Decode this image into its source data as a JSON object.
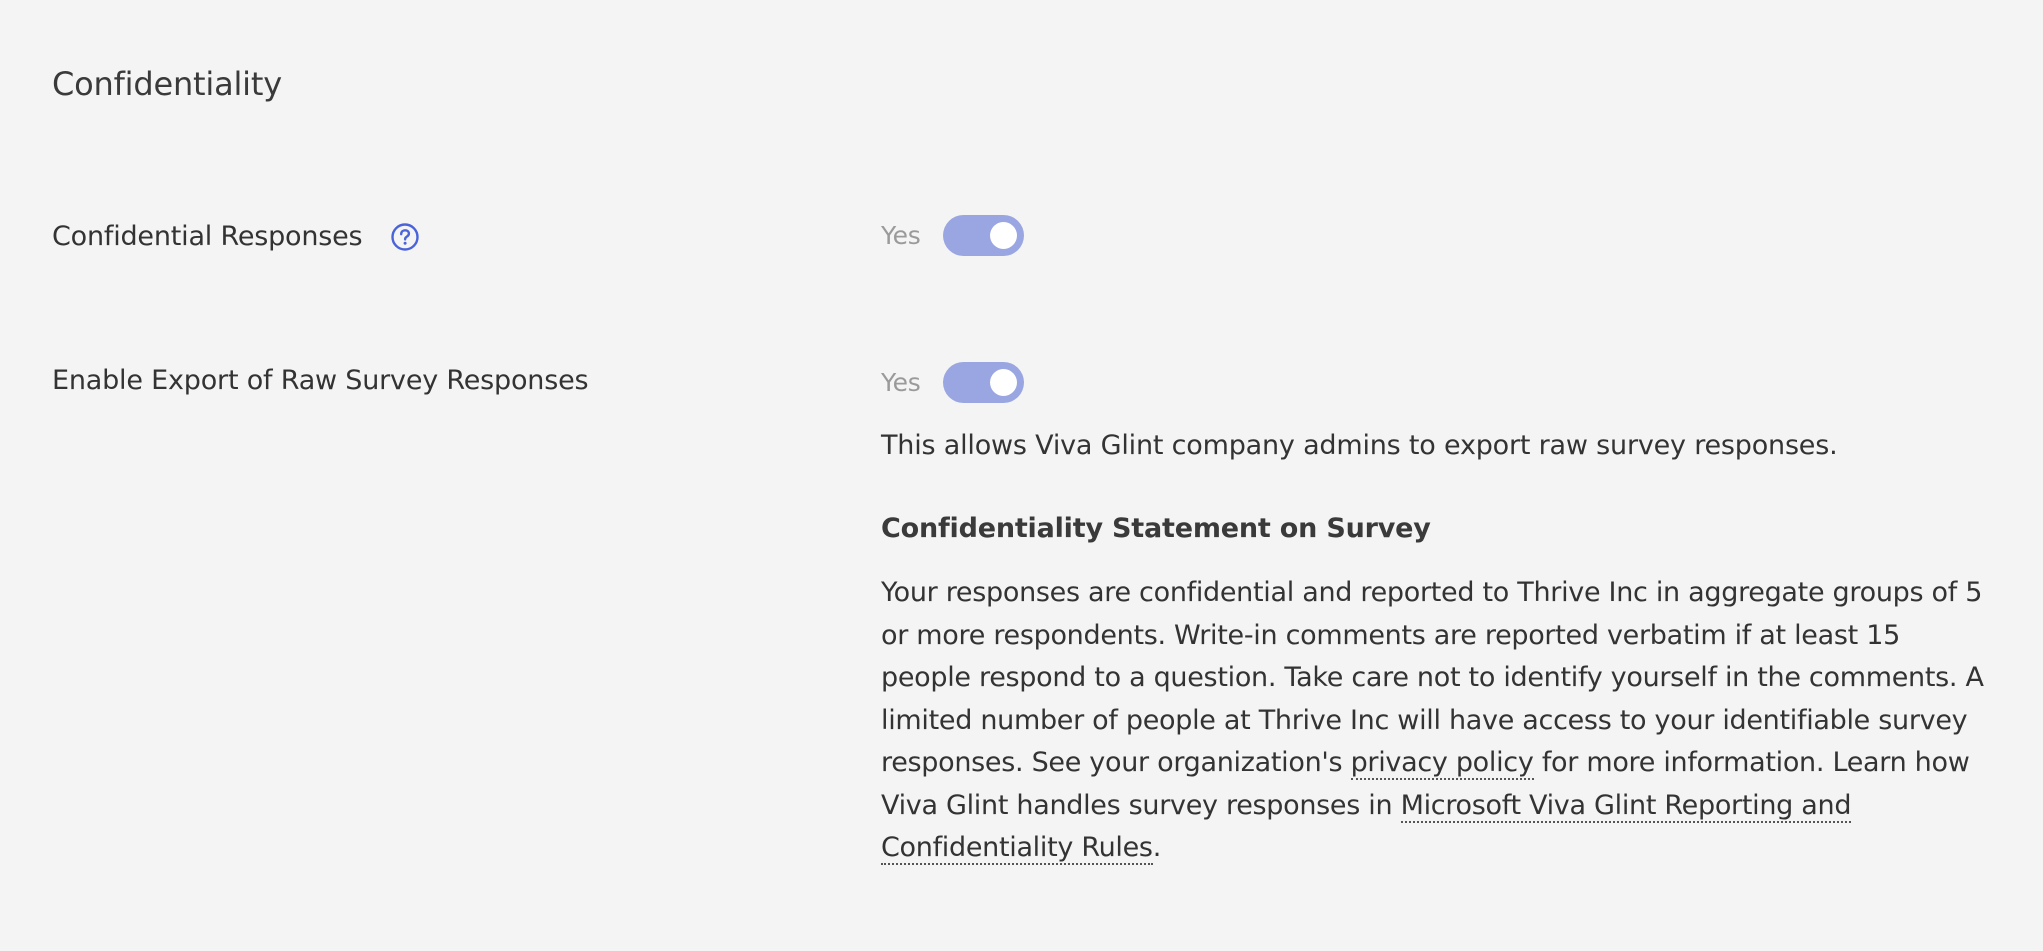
{
  "section": {
    "title": "Confidentiality"
  },
  "settings": [
    {
      "label": "Confidential Responses",
      "value_label": "Yes",
      "enabled": true,
      "has_help": true
    },
    {
      "label": "Enable Export of Raw Survey Responses",
      "value_label": "Yes",
      "enabled": true,
      "description": "This allows Viva Glint company admins to export raw survey responses."
    }
  ],
  "statement": {
    "title": "Confidentiality Statement on Survey",
    "body_part1": "Your responses are confidential and reported to Thrive Inc in aggregate groups of 5 or more respondents. Write-in comments are reported verbatim if at least 15 people respond to a question. Take care not to identify yourself in the comments. A limited number of people at Thrive Inc will have access to your identifiable survey responses. See your organization's ",
    "privacy_link": "privacy policy",
    "body_part2": " for more information. Learn how Viva Glint handles survey responses in ",
    "rules_link": "Microsoft Viva Glint Reporting and Confidentiality Rules",
    "body_part3": "."
  },
  "colors": {
    "background": "#f4f4f4",
    "toggle_on": "#99a6e2",
    "help_icon": "#4a63d8",
    "text": "#333333"
  },
  "icons": {
    "help": "question-circle-icon"
  }
}
